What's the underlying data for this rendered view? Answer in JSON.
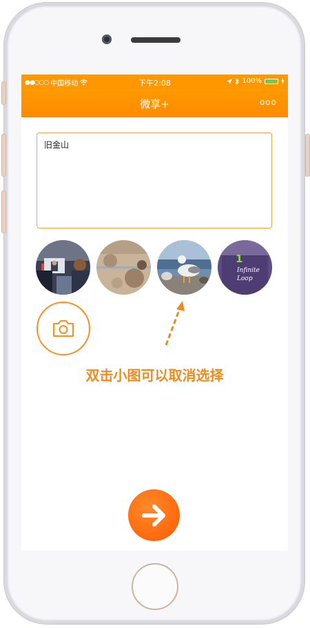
{
  "status_bar": {
    "carrier": "中国移动",
    "time": "下午2:08",
    "battery": "100%"
  },
  "nav": {
    "title": "微享+",
    "more_label": "ooo"
  },
  "compose": {
    "text": "旧金山"
  },
  "thumbnails": [
    {
      "icon": "conference-photo"
    },
    {
      "icon": "beach-photo"
    },
    {
      "icon": "seagull-photo"
    },
    {
      "icon": "infinite-loop-photo",
      "text_line1": "Infinite",
      "text_line2": "Loop",
      "number": "1"
    }
  ],
  "hint": {
    "text": "双击小图可以取消选择"
  },
  "colors": {
    "accent": "#ff8c00",
    "hint": "#f08a1c"
  }
}
